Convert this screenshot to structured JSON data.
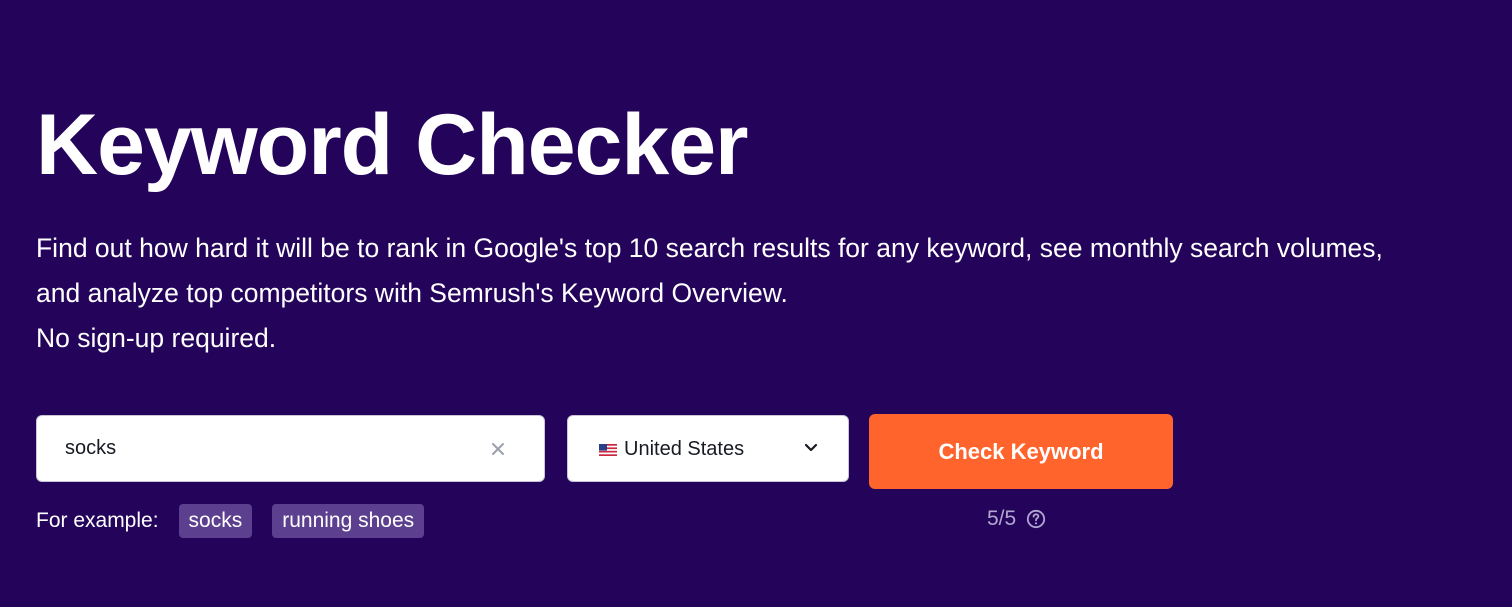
{
  "header": {
    "title": "Keyword Checker",
    "description_lines": [
      "Find out how hard it will be to rank in Google's top 10 search results for any keyword, see monthly search volumes,",
      "and analyze top competitors with Semrush's Keyword Overview.",
      "No sign-up required."
    ]
  },
  "search": {
    "value": "socks",
    "placeholder": "",
    "clear_icon": "close-icon"
  },
  "country": {
    "selected": "United States",
    "flag_icon": "us-flag-icon",
    "dropdown_icon": "chevron-down-icon"
  },
  "actions": {
    "check_label": "Check Keyword"
  },
  "examples": {
    "label": "For example:",
    "items": [
      "socks",
      "running shoes"
    ]
  },
  "limit": {
    "text": "5/5",
    "help_icon": "question-circle-icon"
  },
  "colors": {
    "background": "#24045a",
    "accent": "#ff642d",
    "chip": "#5c3f8f",
    "muted_text": "#b2a7d1"
  }
}
